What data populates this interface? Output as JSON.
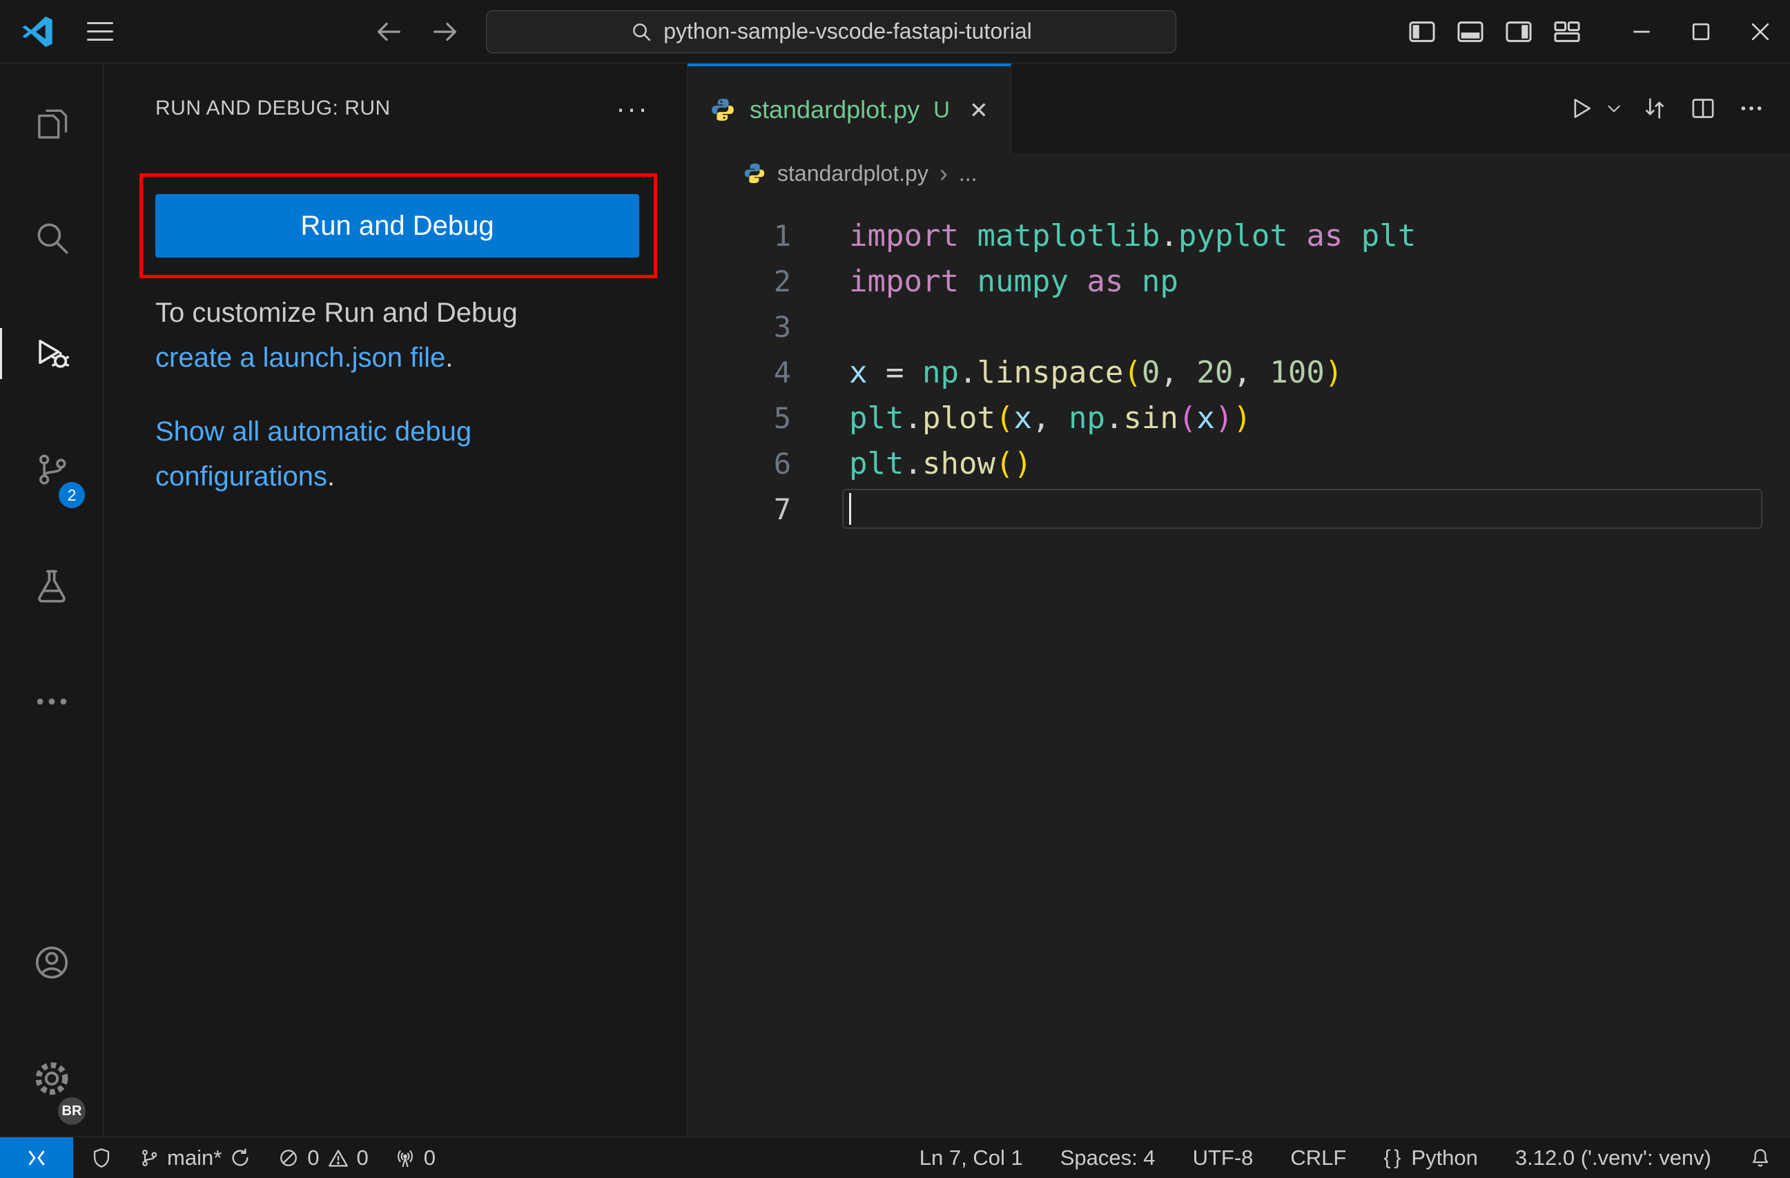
{
  "title_bar": {
    "search_value": "python-sample-vscode-fastapi-tutorial"
  },
  "colors": {
    "accent_blue": "#0078d4",
    "link_blue": "#4daafc",
    "annotation_red": "#ff0000",
    "untracked_green": "#73c991"
  },
  "syntax_colors": {
    "keyword": "#c586c0",
    "module": "#4ec9b0",
    "function": "#dcdcaa",
    "variable": "#9cdcfe",
    "number": "#b5cea8",
    "plain": "#d4d4d4",
    "bracket_outer": "#ffd700",
    "bracket_inner": "#da70d6"
  },
  "activity_bar": {
    "scm_badge": "2",
    "profile_badge": "BR"
  },
  "sidebar": {
    "title": "RUN AND DEBUG: RUN",
    "more_icon": "···",
    "run_button_label": "Run and Debug",
    "customize_line1": "To customize Run and Debug",
    "customize_link": "create a launch.json file",
    "customize_period": ".",
    "show_all_link_line1": "Show all automatic debug",
    "show_all_link_line2": "configurations",
    "show_all_period": "."
  },
  "editor": {
    "tab_label": "standardplot.py",
    "tab_modified": "U",
    "tab_close": "✕",
    "breadcrumb_file": "standardplot.py",
    "breadcrumb_chevron": "›",
    "breadcrumb_more": "...",
    "code_lines": [
      {
        "n": "1",
        "tokens": [
          [
            "import",
            "kw"
          ],
          [
            " ",
            "pl"
          ],
          [
            "matplotlib",
            "mod"
          ],
          [
            ".",
            "pl"
          ],
          [
            "pyplot",
            "mod"
          ],
          [
            " ",
            "pl"
          ],
          [
            "as",
            "kw"
          ],
          [
            " ",
            "pl"
          ],
          [
            "plt",
            "mod"
          ]
        ]
      },
      {
        "n": "2",
        "tokens": [
          [
            "import",
            "kw"
          ],
          [
            " ",
            "pl"
          ],
          [
            "numpy",
            "mod"
          ],
          [
            " ",
            "pl"
          ],
          [
            "as",
            "kw"
          ],
          [
            " ",
            "pl"
          ],
          [
            "np",
            "mod"
          ]
        ]
      },
      {
        "n": "3",
        "tokens": []
      },
      {
        "n": "4",
        "tokens": [
          [
            "x",
            "var"
          ],
          [
            " = ",
            "pl"
          ],
          [
            "np",
            "mod"
          ],
          [
            ".",
            "pl"
          ],
          [
            "linspace",
            "fn"
          ],
          [
            "(",
            "p1"
          ],
          [
            "0",
            "num"
          ],
          [
            ", ",
            "pl"
          ],
          [
            "20",
            "num"
          ],
          [
            ", ",
            "pl"
          ],
          [
            "100",
            "num"
          ],
          [
            ")",
            "p1"
          ]
        ]
      },
      {
        "n": "5",
        "tokens": [
          [
            "plt",
            "mod"
          ],
          [
            ".",
            "pl"
          ],
          [
            "plot",
            "fn"
          ],
          [
            "(",
            "p1"
          ],
          [
            "x",
            "var"
          ],
          [
            ", ",
            "pl"
          ],
          [
            "np",
            "mod"
          ],
          [
            ".",
            "pl"
          ],
          [
            "sin",
            "fn"
          ],
          [
            "(",
            "p2"
          ],
          [
            "x",
            "var"
          ],
          [
            ")",
            "p2"
          ],
          [
            ")",
            "p1"
          ]
        ]
      },
      {
        "n": "6",
        "tokens": [
          [
            "plt",
            "mod"
          ],
          [
            ".",
            "pl"
          ],
          [
            "show",
            "fn"
          ],
          [
            "(",
            "p1"
          ],
          [
            ")",
            "p1"
          ]
        ]
      },
      {
        "n": "7",
        "tokens": [],
        "current": true,
        "cursor": true
      }
    ]
  },
  "status_bar": {
    "branch": "main*",
    "errors": "0",
    "warnings": "0",
    "ports": "0",
    "cursor_position": "Ln 7, Col 1",
    "indentation": "Spaces: 4",
    "encoding": "UTF-8",
    "eol": "CRLF",
    "language_braces": "{}",
    "language": "Python",
    "interpreter": "3.12.0 ('.venv': venv)"
  }
}
